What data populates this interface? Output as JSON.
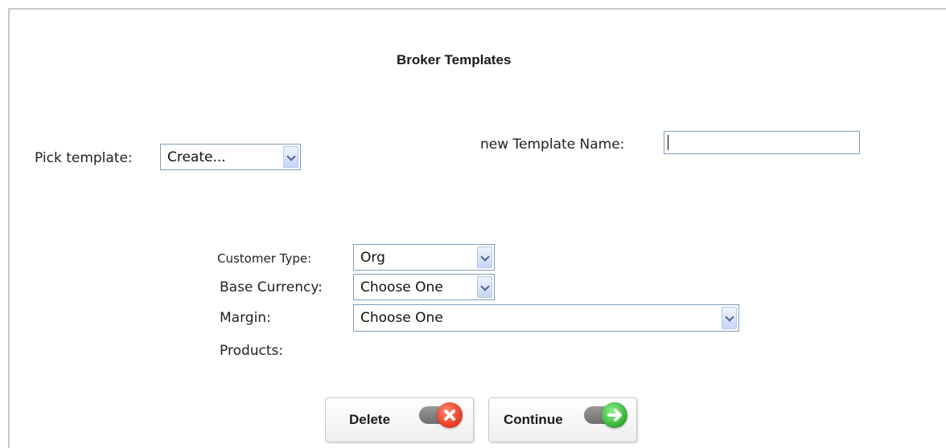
{
  "page": {
    "title": "Broker Templates"
  },
  "pick_template": {
    "label": "Pick template:",
    "selected": "Create..."
  },
  "template_name": {
    "label": "new Template Name:",
    "value": ""
  },
  "form": {
    "customer_type": {
      "label": "Customer Type:",
      "selected": "Org"
    },
    "base_currency": {
      "label": "Base Currency:",
      "selected": "Choose One"
    },
    "margin": {
      "label": "Margin:",
      "selected": "Choose One"
    },
    "products": {
      "label": "Products:"
    }
  },
  "actions": {
    "delete": {
      "label": "Delete",
      "icon": "close-icon",
      "color": "#e8412a"
    },
    "continue": {
      "label": "Continue",
      "icon": "arrow-right-icon",
      "color": "#3cb83c"
    }
  }
}
